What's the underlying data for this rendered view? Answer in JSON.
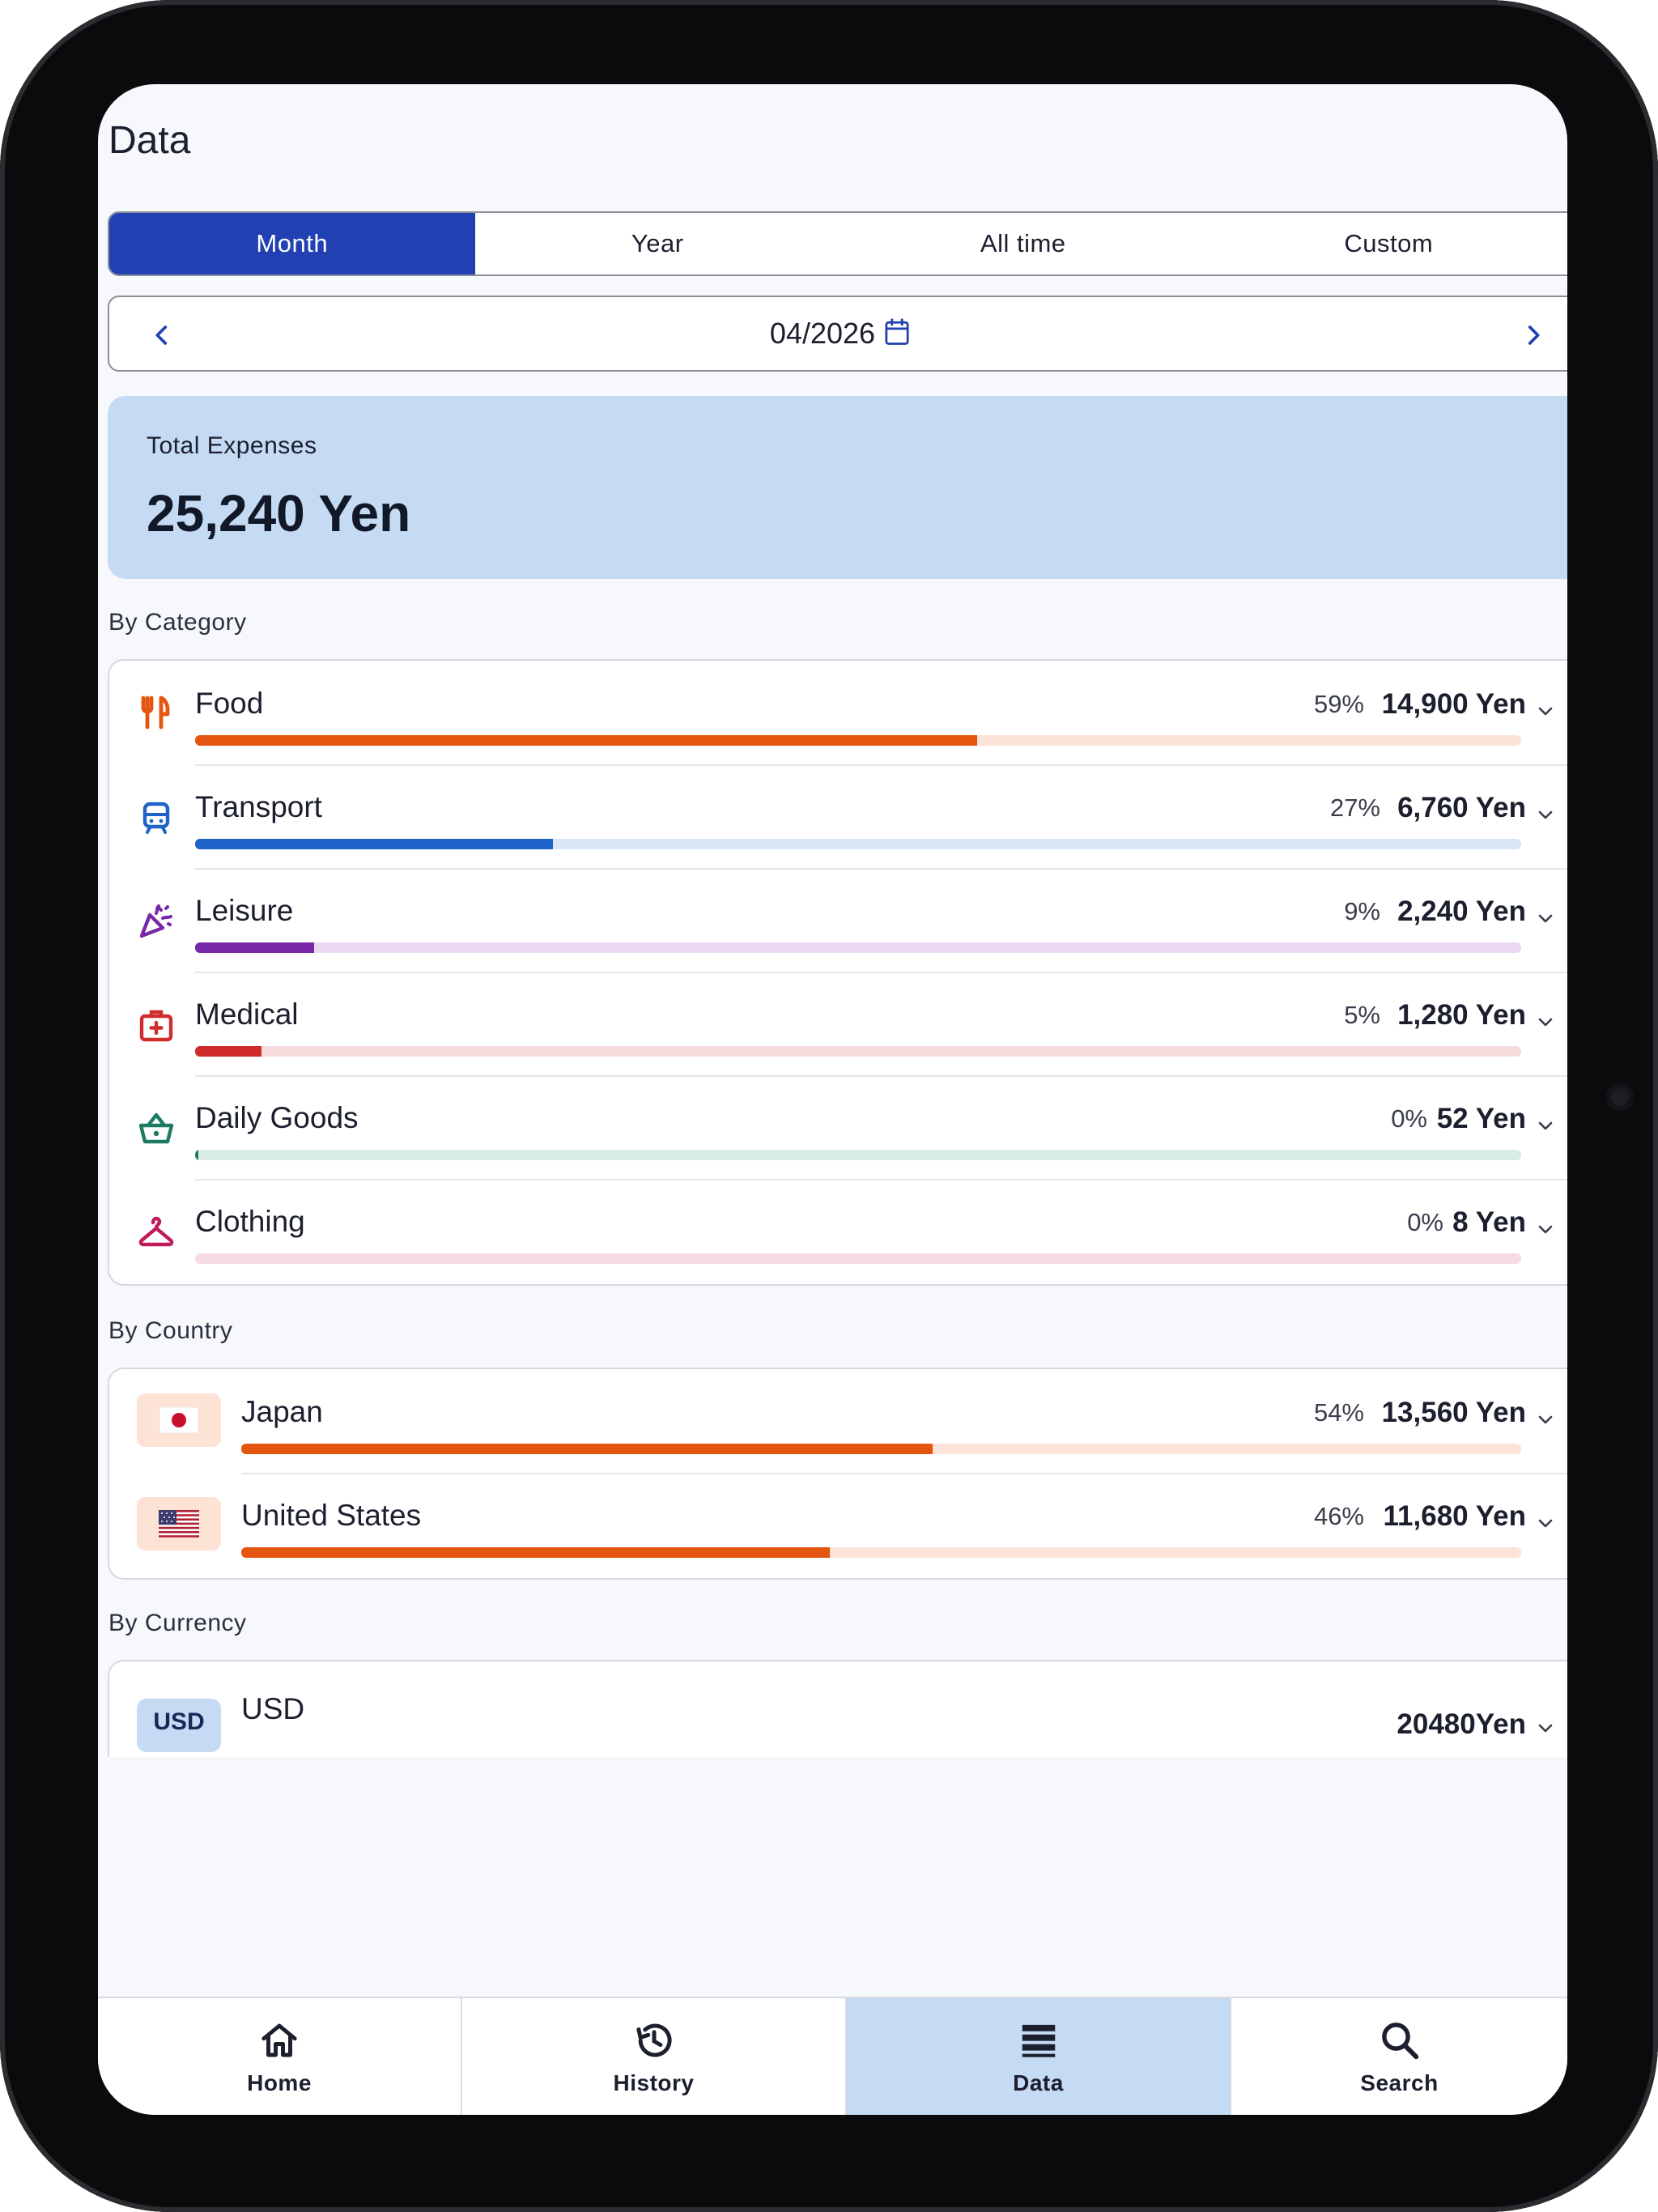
{
  "header": {
    "title": "Data"
  },
  "period_tabs": [
    {
      "label": "Month",
      "active": true
    },
    {
      "label": "Year",
      "active": false
    },
    {
      "label": "All time",
      "active": false
    },
    {
      "label": "Custom",
      "active": false
    }
  ],
  "date_picker": {
    "value": "04/2026",
    "prev_icon": "chevron-left-icon",
    "next_icon": "chevron-right-icon",
    "calendar_icon": "calendar-icon"
  },
  "total": {
    "label": "Total Expenses",
    "value": "25,240 Yen"
  },
  "by_category": {
    "title": "By Category",
    "items": [
      {
        "name": "Food",
        "percent": "59%",
        "amount": "14,900 Yen",
        "share": 0.59,
        "icon": "utensils-icon",
        "color": "#e4560f",
        "track": "#fbe3d7"
      },
      {
        "name": "Transport",
        "percent": "27%",
        "amount": "6,760 Yen",
        "share": 0.27,
        "icon": "train-icon",
        "color": "#1f63c8",
        "track": "#d9e6f6"
      },
      {
        "name": "Leisure",
        "percent": "9%",
        "amount": "2,240 Yen",
        "share": 0.09,
        "icon": "party-popper-icon",
        "color": "#7727a8",
        "track": "#ead9f0"
      },
      {
        "name": "Medical",
        "percent": "5%",
        "amount": "1,280 Yen",
        "share": 0.05,
        "icon": "first-aid-icon",
        "color": "#d02c2c",
        "track": "#f6dcdc"
      },
      {
        "name": "Daily Goods",
        "percent": "0%",
        "amount": "52 Yen",
        "share": 0.002,
        "icon": "basket-icon",
        "color": "#1e7a63",
        "track": "#d9ece6"
      },
      {
        "name": "Clothing",
        "percent": "0%",
        "amount": "8 Yen",
        "share": 0.0,
        "icon": "hanger-icon",
        "color": "#c01c5b",
        "track": "#f7dbe4"
      }
    ]
  },
  "by_country": {
    "title": "By Country",
    "items": [
      {
        "name": "Japan",
        "percent": "54%",
        "amount": "13,560 Yen",
        "share": 0.54,
        "icon": "japan-flag-icon",
        "color": "#e4560f",
        "track": "#fbe3d7"
      },
      {
        "name": "United States",
        "percent": "46%",
        "amount": "11,680 Yen",
        "share": 0.46,
        "icon": "us-flag-icon",
        "color": "#e4560f",
        "track": "#fbe3d7"
      }
    ]
  },
  "by_currency": {
    "title": "By Currency",
    "items": [
      {
        "code": "USD",
        "name": "USD",
        "amount": "20480Yen"
      }
    ]
  },
  "bottom_nav": [
    {
      "label": "Home",
      "icon": "home-icon",
      "active": false
    },
    {
      "label": "History",
      "icon": "history-icon",
      "active": false
    },
    {
      "label": "Data",
      "icon": "list-icon",
      "active": true
    },
    {
      "label": "Search",
      "icon": "search-icon",
      "active": false
    }
  ]
}
